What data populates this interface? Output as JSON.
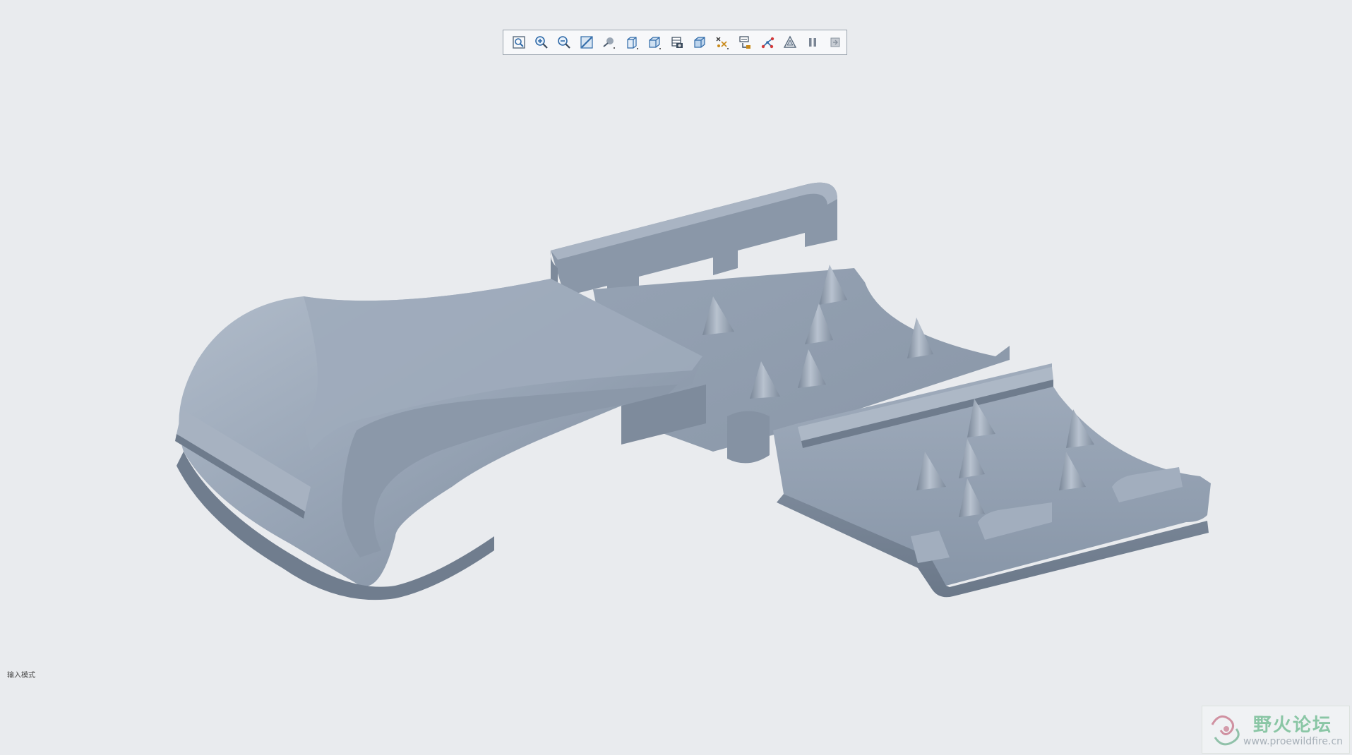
{
  "toolbar": {
    "buttons": [
      {
        "name": "refit-icon"
      },
      {
        "name": "zoom-in-icon"
      },
      {
        "name": "zoom-out-icon"
      },
      {
        "name": "repaint-icon"
      },
      {
        "name": "display-style-icon"
      },
      {
        "name": "saved-views-icon"
      },
      {
        "name": "view-manager-icon"
      },
      {
        "name": "perspective-view-icon"
      },
      {
        "name": "section-view-icon"
      },
      {
        "name": "datum-display-icon"
      },
      {
        "name": "annotation-display-icon"
      },
      {
        "name": "spin-center-icon"
      },
      {
        "name": "appearance-icon"
      },
      {
        "name": "pause-icon"
      },
      {
        "name": "exit-icon"
      }
    ]
  },
  "status": {
    "text": "输入模式"
  },
  "watermark": {
    "title": "野火论坛",
    "url": "www.proewildfire.cn"
  },
  "colors": {
    "background": "#e9ebee",
    "model_light": "#a3afbf",
    "model_mid": "#8c99aa",
    "model_dark": "#6f7c8d"
  }
}
